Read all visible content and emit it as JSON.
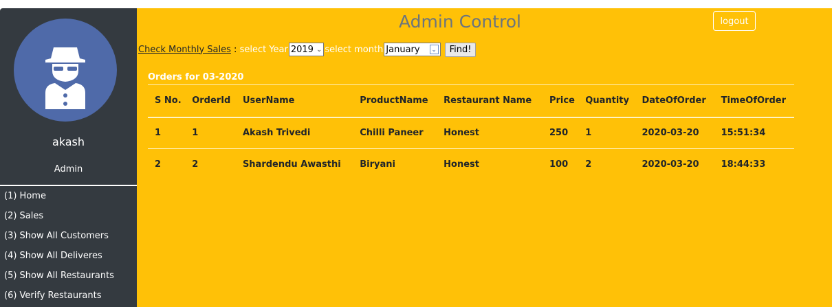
{
  "sidebar": {
    "user_name": "akash",
    "user_role": "Admin",
    "avatar_icon": "spy-user-icon",
    "nav_items": [
      {
        "label": "(1) Home"
      },
      {
        "label": "(2) Sales"
      },
      {
        "label": "(3) Show All Customers"
      },
      {
        "label": "(4) Show All Deliveres"
      },
      {
        "label": "(5) Show All Restaurants"
      },
      {
        "label": "(6) Verify Restaurants"
      }
    ]
  },
  "header": {
    "title": "Admin Control",
    "logout_label": "logout"
  },
  "filter": {
    "check_sales_label": "Check Monthly Sales",
    "colon": " : ",
    "select_year_label": "select Year",
    "year_value": "2019",
    "select_month_label": "select month",
    "month_value": "January",
    "find_label": "Find!"
  },
  "orders": {
    "caption": "Orders for 03-2020",
    "columns": [
      "S No.",
      "OrderId",
      "UserName",
      "ProductName",
      "Restaurant Name",
      "Price",
      "Quantity",
      "DateOfOrder",
      "TimeOfOrder"
    ],
    "rows": [
      [
        "1",
        "1",
        "Akash Trivedi",
        "Chilli Paneer",
        "Honest",
        "250",
        "1",
        "2020-03-20",
        "15:51:34"
      ],
      [
        "2",
        "2",
        "Shardendu Awasthi",
        "Biryani",
        "Honest",
        "100",
        "2",
        "2020-03-20",
        "18:44:33"
      ]
    ]
  },
  "colors": {
    "main_bg": "#ffc107",
    "sidebar_bg": "#343a40",
    "avatar_bg": "#4f6aa9",
    "title_color": "#6c757d"
  }
}
